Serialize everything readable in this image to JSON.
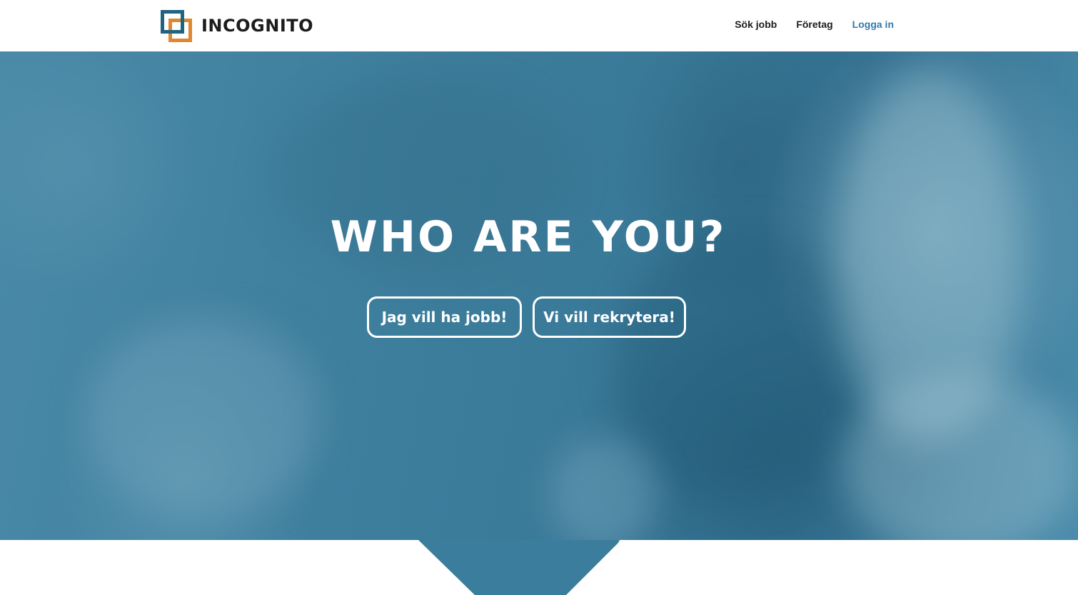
{
  "brand": {
    "name": "INCOGNITO",
    "colors": {
      "primary": "#1f6581",
      "accent": "#e0872f",
      "link": "#2e7dab"
    }
  },
  "nav": {
    "items": [
      {
        "label": "Sök jobb"
      },
      {
        "label": "Företag"
      },
      {
        "label": "Logga in"
      }
    ]
  },
  "hero": {
    "title": "WHO ARE YOU?",
    "buttons": [
      {
        "label": "Jag vill ha jobb!"
      },
      {
        "label": "Vi vill rekrytera!"
      }
    ],
    "overlay_color": "#3b7d9c"
  }
}
